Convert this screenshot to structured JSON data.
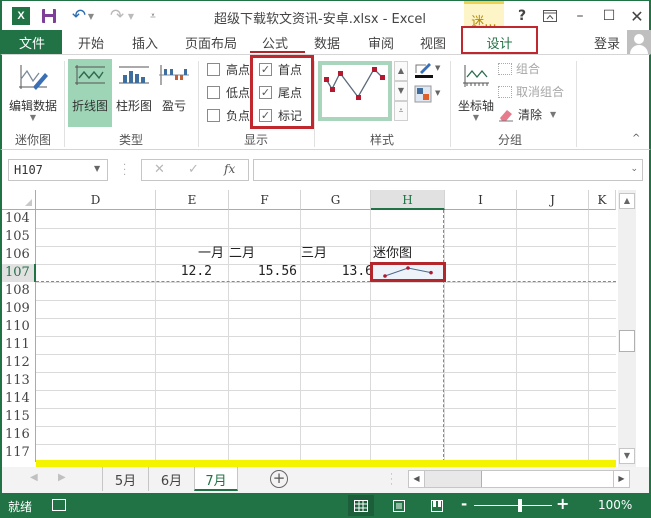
{
  "titlebar": {
    "app_icon_label": "X",
    "title": "超级下载软文资讯-安卓.xlsx - Excel",
    "context_tab_header": "迷...",
    "help": "?",
    "undo_glyph": "↶",
    "redo_glyph": "↷",
    "minimize": "–",
    "maximize": "☐",
    "close": "✕",
    "ribbon_display": "⊼"
  },
  "tabs": {
    "file": "文件",
    "items": [
      "开始",
      "插入",
      "页面布局",
      "公式",
      "数据",
      "审阅",
      "视图",
      "设计"
    ],
    "active": "设计",
    "login": "登录"
  },
  "ribbon": {
    "groups": {
      "sparkline": {
        "label": "迷你图",
        "edit_data": "编辑数据"
      },
      "type": {
        "label": "类型",
        "line": "折线图",
        "column": "柱形图",
        "win_loss": "盈亏",
        "selected": "折线图"
      },
      "show": {
        "label": "显示",
        "items": [
          {
            "label": "高点",
            "checked": false
          },
          {
            "label": "低点",
            "checked": false
          },
          {
            "label": "负点",
            "checked": false
          },
          {
            "label": "首点",
            "checked": true
          },
          {
            "label": "尾点",
            "checked": true
          },
          {
            "label": "标记",
            "checked": true
          }
        ],
        "check_glyph": "✓"
      },
      "style": {
        "label": "样式",
        "sparkline_color": "#7b1c2e",
        "marker_color": "#b3192f"
      },
      "group": {
        "label": "分组",
        "axis": "坐标轴",
        "group_btn": "组合",
        "ungroup": "取消组合",
        "clear": "清除"
      }
    },
    "collapse": "^"
  },
  "formula_bar": {
    "name_box": "H107",
    "cancel": "✕",
    "enter": "✓",
    "fx": "fx",
    "formula": ""
  },
  "sheet": {
    "columns": [
      "D",
      "E",
      "F",
      "G",
      "H",
      "I",
      "J",
      "K"
    ],
    "selected_column": "H",
    "rows": [
      "104",
      "105",
      "106",
      "107",
      "108",
      "109",
      "110",
      "111",
      "112",
      "113",
      "114",
      "115",
      "116",
      "117"
    ],
    "selected_row": "107",
    "cells": {
      "E106": "一月",
      "F106": "二月",
      "G106": "三月",
      "H106": "迷你图",
      "E107": "12.2",
      "F107": "15.56",
      "G107": "13.6"
    },
    "sparkline_values": [
      12.2,
      15.56,
      13.6
    ]
  },
  "sheet_tabs": {
    "items": [
      "5月",
      "6月",
      "7月"
    ],
    "active": "7月",
    "add": "+"
  },
  "status": {
    "text": "就绪",
    "zoom": "100%",
    "zoom_minus": "-",
    "zoom_plus": "+"
  }
}
